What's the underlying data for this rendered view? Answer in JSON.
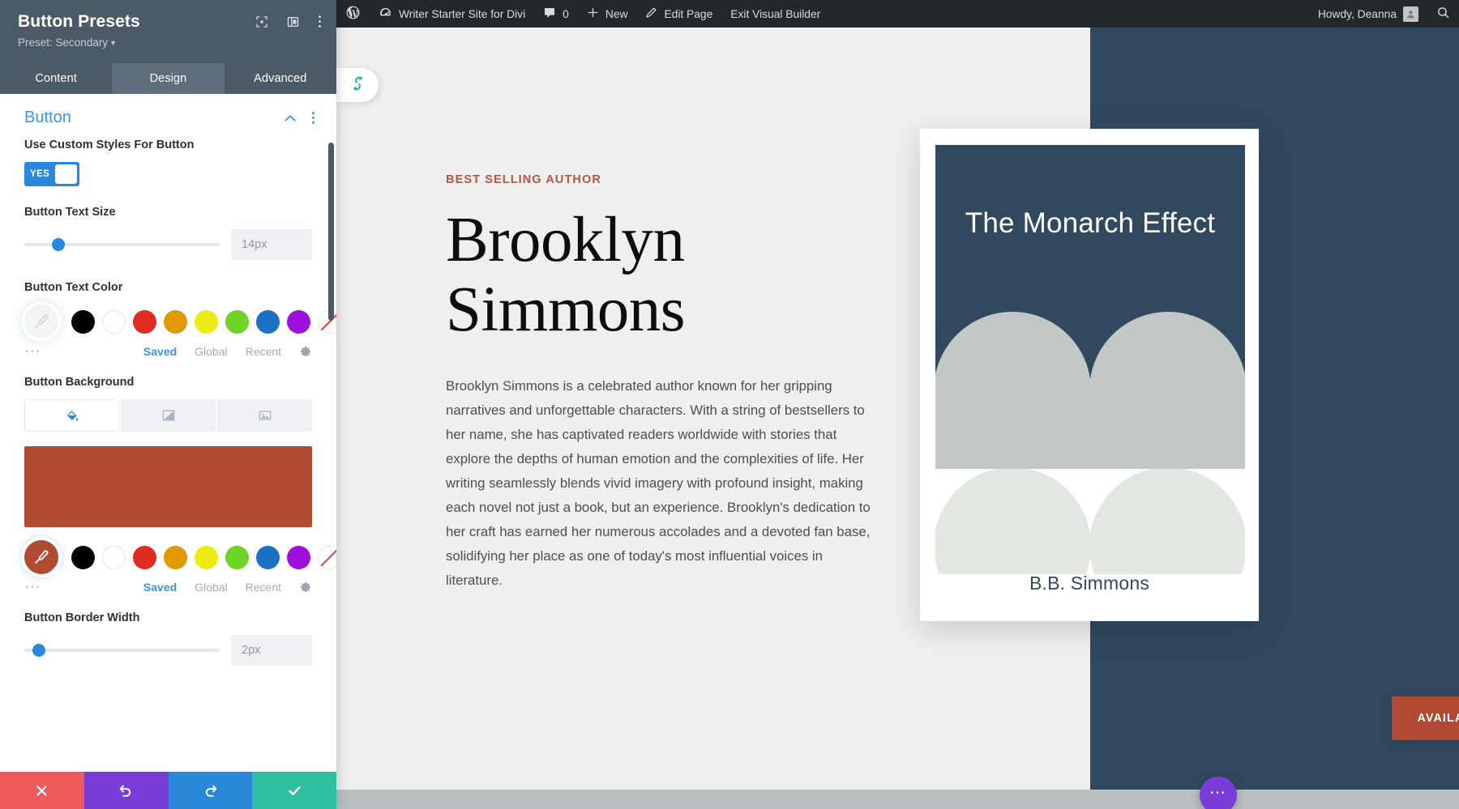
{
  "panel": {
    "title": "Button Presets",
    "preset_label": "Preset: Secondary",
    "header_icons": [
      {
        "name": "focus-icon"
      },
      {
        "name": "layout-icon"
      },
      {
        "name": "more-vertical-icon"
      }
    ],
    "tabs": [
      {
        "label": "Content",
        "active": false
      },
      {
        "label": "Design",
        "active": true
      },
      {
        "label": "Advanced",
        "active": false
      }
    ],
    "section": {
      "title": "Button",
      "collapse_icon": "chevron-up-icon",
      "more_icon": "more-vertical-icon"
    },
    "fields": {
      "custom_styles": {
        "label": "Use Custom Styles For Button",
        "toggle_value": "YES"
      },
      "text_size": {
        "label": "Button Text Size",
        "value": "14px",
        "slider_percent": 14
      },
      "text_color": {
        "label": "Button Text Color",
        "selected": "none",
        "swatches": [
          "#000000",
          "#ffffff",
          "#e02b20",
          "#e09900",
          "#edeb11",
          "#6fd326",
          "#1b72c4",
          "#9e0fdb",
          "none"
        ],
        "links": [
          {
            "label": "Saved",
            "active": true
          },
          {
            "label": "Global",
            "active": false
          },
          {
            "label": "Recent",
            "active": false
          }
        ],
        "gear_icon": "gear-icon",
        "dots_icon": "more-horizontal-icon"
      },
      "background": {
        "label": "Button Background",
        "type_tabs": [
          {
            "name": "background-color-tab",
            "icon": "paint-bucket-icon",
            "active": true
          },
          {
            "name": "background-gradient-tab",
            "icon": "gradient-icon",
            "active": false
          },
          {
            "name": "background-image-tab",
            "icon": "image-icon",
            "active": false
          }
        ],
        "preview_color": "#b04a33",
        "selected": "#b04a33",
        "swatches": [
          "#000000",
          "#ffffff",
          "#e02b20",
          "#e09900",
          "#edeb11",
          "#6fd326",
          "#1b72c4",
          "#9e0fdb",
          "none"
        ],
        "links": [
          {
            "label": "Saved",
            "active": true
          },
          {
            "label": "Global",
            "active": false
          },
          {
            "label": "Recent",
            "active": false
          }
        ],
        "gear_icon": "gear-icon",
        "dots_icon": "more-horizontal-icon"
      },
      "border_width": {
        "label": "Button Border Width",
        "value": "2px",
        "slider_percent": 4
      }
    },
    "footer_buttons": [
      {
        "name": "discard-button",
        "icon": "close-icon",
        "color": "#ec5a5a"
      },
      {
        "name": "undo-button",
        "icon": "undo-icon",
        "color": "#7a3ed8"
      },
      {
        "name": "redo-button",
        "icon": "redo-icon",
        "color": "#2b87da"
      },
      {
        "name": "save-button",
        "icon": "check-icon",
        "color": "#2ec0a0"
      }
    ]
  },
  "adminbar": {
    "wp_logo": "wordpress-logo-icon",
    "site_name": "Writer Starter Site for Divi",
    "site_icon": "dashboard-icon",
    "comments_icon": "comment-icon",
    "comments_count": "0",
    "new_icon": "plus-icon",
    "new_label": "New",
    "edit_icon": "pencil-icon",
    "edit_label": "Edit Page",
    "exit_label": "Exit Visual Builder",
    "howdy": "Howdy, Deanna",
    "avatar_icon": "avatar-icon",
    "search_icon": "search-icon"
  },
  "page": {
    "divi_tab_icon": "divi-logo-icon",
    "eyebrow": "BEST SELLING AUTHOR",
    "heading": "Brooklyn Simmons",
    "paragraph": "Brooklyn Simmons is a celebrated author known for her gripping narratives and unforgettable characters. With a string of bestsellers to her name, she has captivated readers worldwide with stories that explore the depths of human emotion and the complexities of life. Her writing seamlessly blends vivid imagery with profound insight, making each novel not just a book, but an experience. Brooklyn's dedication to her craft has earned her numerous accolades and a devoted fan base, solidifying her place as one of today's most influential voices in literature.",
    "book": {
      "title": "The Monarch Effect",
      "author": "B.B. Simmons",
      "navy": "#31495f",
      "sage": "#c2c9c4",
      "sage_light": "#e3e7e2"
    },
    "cta_label": "AVAILABLE NOW",
    "cta_color": "#b04a33",
    "fab_icon": "more-horizontal-icon"
  }
}
